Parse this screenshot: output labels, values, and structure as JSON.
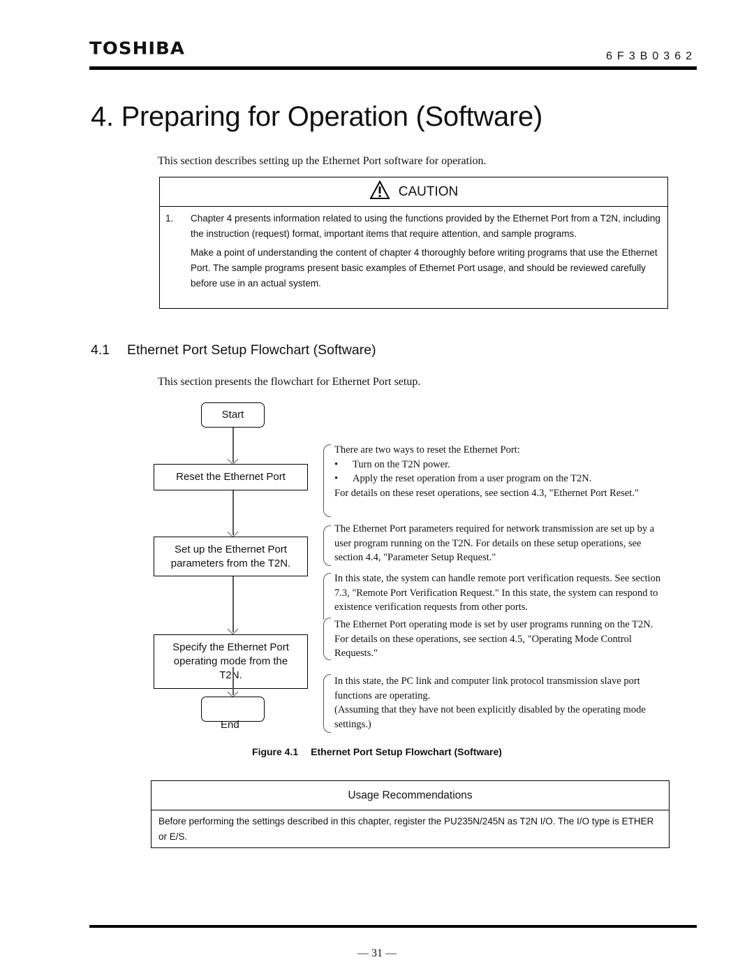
{
  "header": {
    "brand": "TOSHIBA",
    "doc_number": "6F3B0362"
  },
  "chapter": {
    "title": "4.  Preparing for Operation (Software)",
    "intro": "This section describes setting up the Ethernet Port software for operation."
  },
  "caution": {
    "icon": "warning-triangle-icon",
    "title": "CAUTION",
    "item_number": "1.",
    "paragraphs": [
      "Chapter 4 presents information related to using the functions provided by the Ethernet Port from a T2N, including the instruction (request) format, important items that require attention, and sample programs.",
      "Make a point of understanding the content of chapter 4 thoroughly before writing programs that use the Ethernet Port. The sample programs present basic examples of Ethernet Port usage, and should be reviewed carefully before use in an actual system."
    ]
  },
  "section": {
    "number": "4.1",
    "title": "Ethernet Port Setup Flowchart (Software)",
    "intro": "This section presents the flowchart for Ethernet Port setup."
  },
  "flowchart": {
    "start": "Start",
    "steps": [
      "Reset the Ethernet Port",
      "Set up the Ethernet Port parameters from the T2N.",
      "Specify the Ethernet Port operating mode from the T2N."
    ],
    "end": "End"
  },
  "notes": {
    "reset": {
      "lead": "There are two ways to reset the Ethernet Port:",
      "bullets": [
        "Turn on the T2N power.",
        "Apply the reset operation from a user program on the T2N."
      ],
      "tail": "For details on these reset operations, see section 4.3, \"Ethernet Port Reset.\""
    },
    "parameters": "The Ethernet Port parameters required for network transmission are set up by a user program running on the T2N. For details on these setup operations, see section 4.4, \"Parameter Setup Request.\"",
    "remote_verification": "In this state, the system can handle remote port verification requests. See section 7.3, \"Remote Port Verification Request.\" In this state, the system can respond to existence verification requests from other ports.",
    "operating_mode": "The Ethernet Port operating mode is set by user programs running on the T2N. For details on these operations, see section 4.5, \"Operating Mode Control Requests.\"",
    "operating_state_1": "In this state, the PC link and computer link protocol transmission slave port functions are operating.",
    "operating_state_2": "(Assuming that they have not been explicitly disabled by the operating mode settings.)"
  },
  "figure": {
    "label": "Figure 4.1",
    "caption": "Ethernet Port Setup Flowchart (Software)"
  },
  "usage": {
    "title": "Usage Recommendations",
    "body": "Before performing the settings described in this chapter, register the PU235N/245N as T2N I/O. The I/O type is ETHER or E/S."
  },
  "footer": {
    "page_number": "— 31 —"
  }
}
